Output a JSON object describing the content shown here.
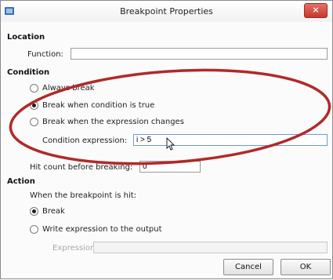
{
  "window": {
    "title": "Breakpoint Properties",
    "close_glyph": "×"
  },
  "location": {
    "heading": "Location",
    "function_label": "Function:",
    "function_value": ""
  },
  "condition": {
    "heading": "Condition",
    "options": [
      "Always break",
      "Break when condition is true",
      "Break when the expression changes"
    ],
    "selected_index": 1,
    "expression_label": "Condition expression:",
    "expression_value": "i > 5"
  },
  "hit_count": {
    "label": "Hit count before breaking:",
    "value": "0"
  },
  "action": {
    "heading": "Action",
    "description": "When the breakpoint is hit:",
    "options": [
      "Break",
      "Write expression to the output"
    ],
    "selected_index": 0,
    "expression_label": "Expression:",
    "expression_value": ""
  },
  "buttons": {
    "cancel": "Cancel",
    "ok": "OK"
  },
  "colors": {
    "annotation": "#b02a28",
    "close_button": "#c8372b",
    "focus_border": "#6b9bd2"
  }
}
